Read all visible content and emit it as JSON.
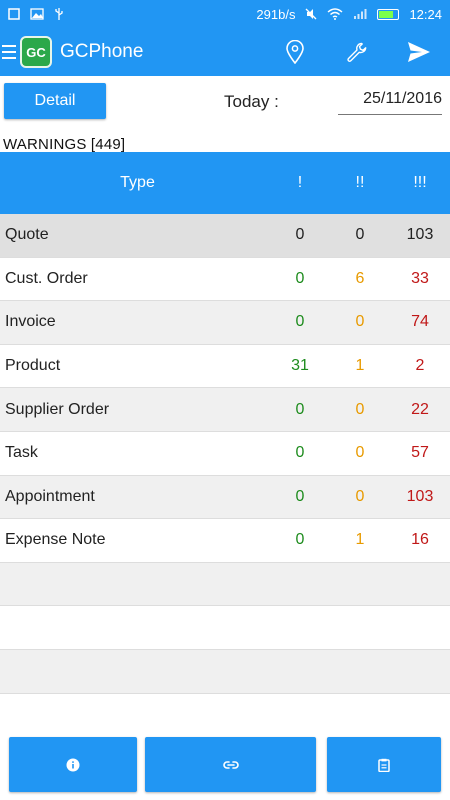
{
  "status_bar": {
    "speed": "291b/s",
    "time": "12:24"
  },
  "app_bar": {
    "logo_text": "GC",
    "title": "GCPhone"
  },
  "controls": {
    "detail_label": "Detail",
    "today_label": "Today :",
    "date_value": "25/11/2016"
  },
  "warnings_label": "WARNINGS [449]",
  "table": {
    "headers": {
      "type": "Type",
      "n1": "!",
      "n2": "!!",
      "n3": "!!!"
    },
    "rows": [
      {
        "type": "Quote",
        "n1": "0",
        "n2": "0",
        "n3": "103"
      },
      {
        "type": "Cust. Order",
        "n1": "0",
        "n2": "6",
        "n3": "33"
      },
      {
        "type": "Invoice",
        "n1": "0",
        "n2": "0",
        "n3": "74"
      },
      {
        "type": "Product",
        "n1": "31",
        "n2": "1",
        "n3": "2"
      },
      {
        "type": "Supplier Order",
        "n1": "0",
        "n2": "0",
        "n3": "22"
      },
      {
        "type": "Task",
        "n1": "0",
        "n2": "0",
        "n3": "57"
      },
      {
        "type": "Appointment",
        "n1": "0",
        "n2": "0",
        "n3": "103"
      },
      {
        "type": "Expense Note",
        "n1": "0",
        "n2": "1",
        "n3": "16"
      }
    ]
  },
  "colors": {
    "primary": "#2196f3",
    "level1": "#1e8c1e",
    "level2": "#e89a00",
    "level3": "#c01818"
  },
  "icons": {
    "app_bar": [
      "menu-icon",
      "location-pin-icon",
      "wrench-icon",
      "send-icon"
    ],
    "bottom_bar": [
      "info-icon",
      "link-icon",
      "clipboard-icon"
    ]
  }
}
